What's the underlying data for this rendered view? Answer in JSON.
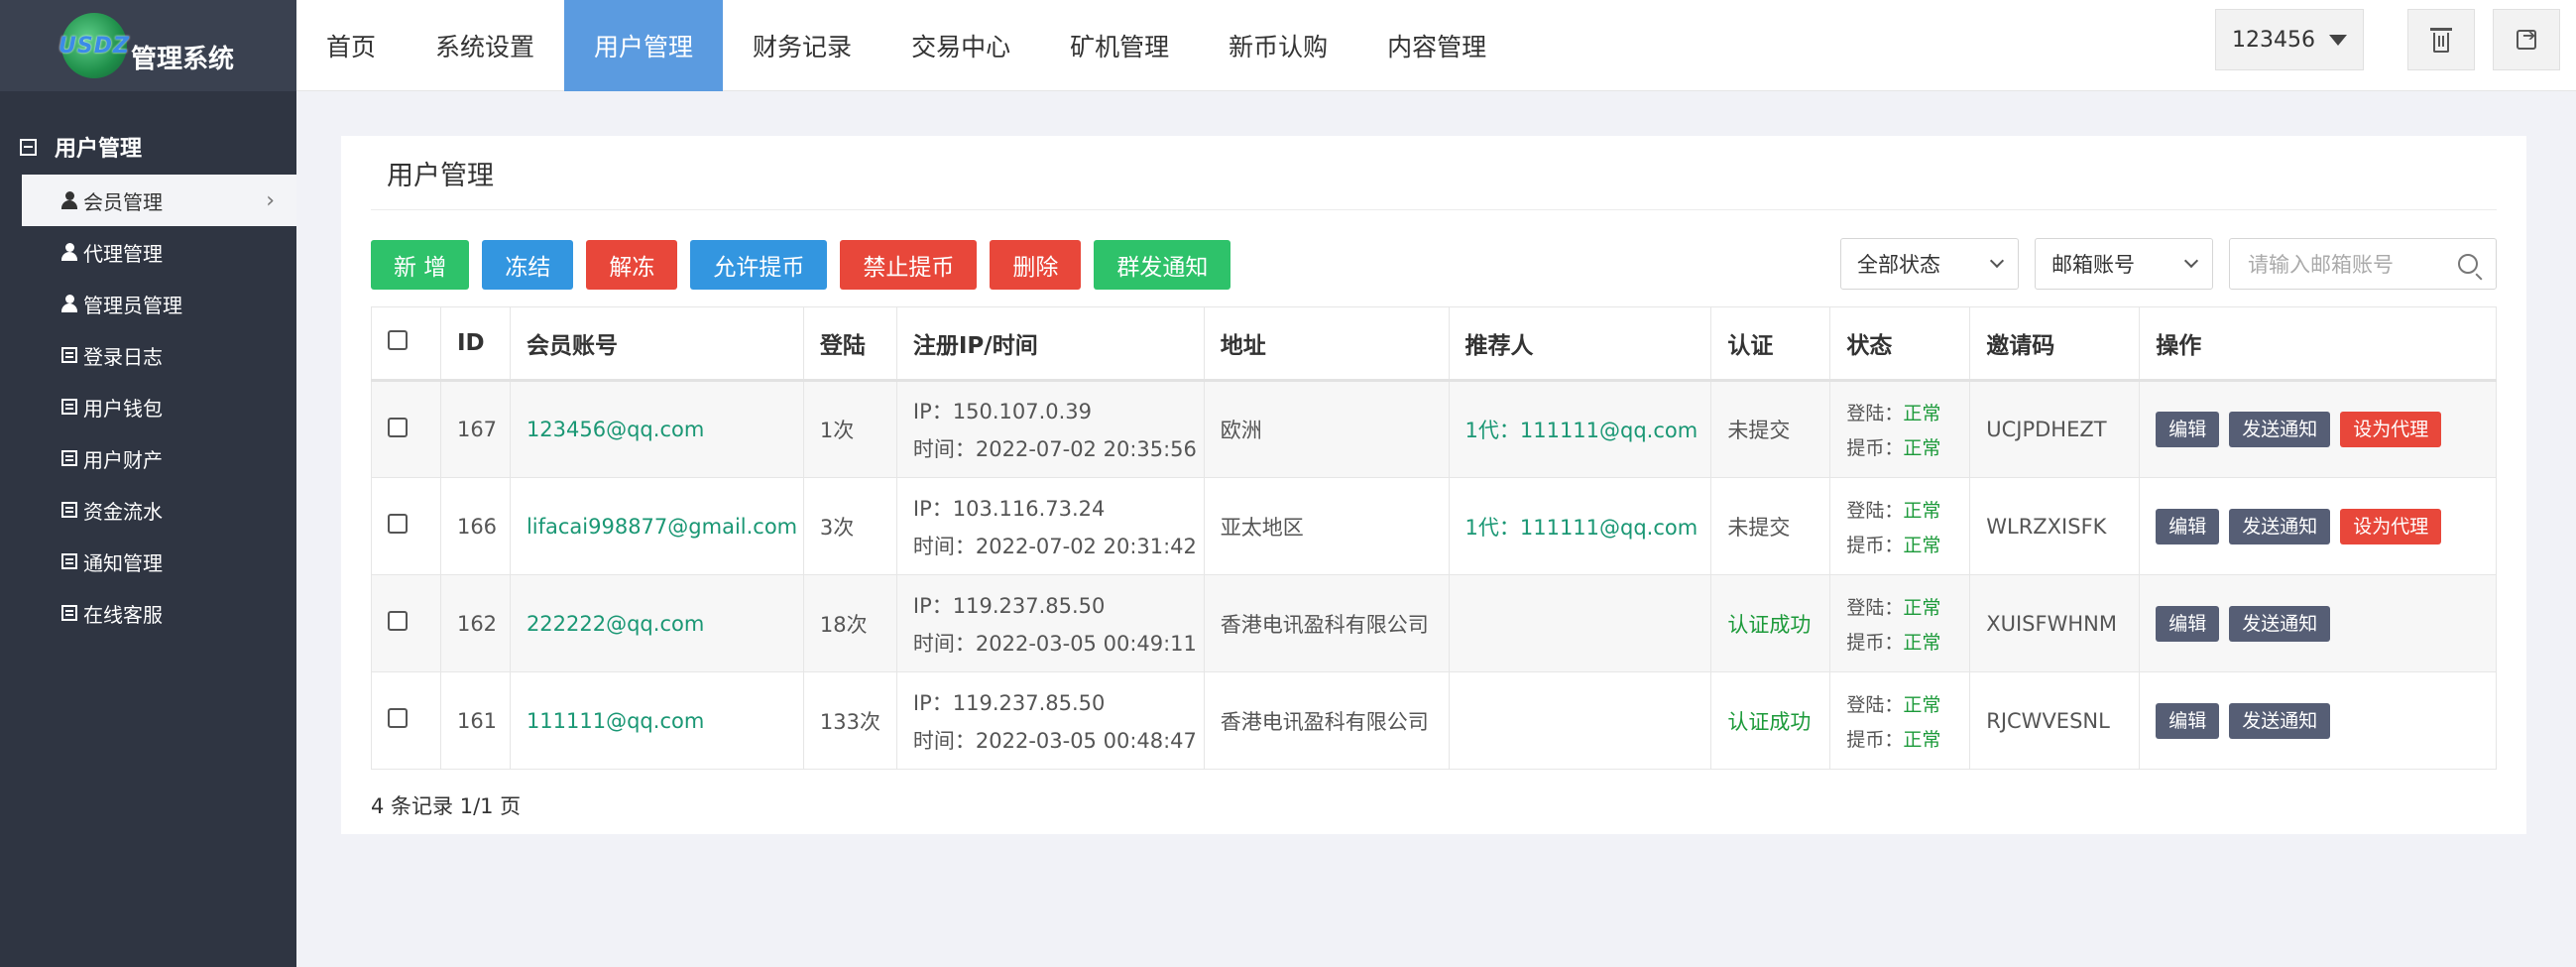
{
  "app": {
    "logo_text": "USDZ",
    "title": "管理系统"
  },
  "sidebar": {
    "group_label": "用户管理",
    "items": [
      {
        "label": "会员管理",
        "icon": "person-icon",
        "active": true
      },
      {
        "label": "代理管理",
        "icon": "person-icon"
      },
      {
        "label": "管理员管理",
        "icon": "person-icon"
      },
      {
        "label": "登录日志",
        "icon": "list-icon"
      },
      {
        "label": "用户钱包",
        "icon": "list-icon"
      },
      {
        "label": "用户财产",
        "icon": "list-icon"
      },
      {
        "label": "资金流水",
        "icon": "list-icon"
      },
      {
        "label": "通知管理",
        "icon": "list-icon"
      },
      {
        "label": "在线客服",
        "icon": "list-icon"
      }
    ]
  },
  "topnav": {
    "items": [
      "首页",
      "系统设置",
      "用户管理",
      "财务记录",
      "交易中心",
      "矿机管理",
      "新币认购",
      "内容管理"
    ],
    "active_index": 2,
    "user": "123456"
  },
  "page": {
    "title": "用户管理",
    "buttons": {
      "add": "新 增",
      "freeze": "冻结",
      "unfreeze": "解冻",
      "allow_withdraw": "允许提币",
      "forbid_withdraw": "禁止提币",
      "delete": "删除",
      "broadcast": "群发通知"
    },
    "filters": {
      "status": "全部状态",
      "field": "邮箱账号",
      "search_placeholder": "请输入邮箱账号"
    },
    "table": {
      "headers": [
        "ID",
        "会员账号",
        "登陆",
        "注册IP/时间",
        "地址",
        "推荐人",
        "认证",
        "状态",
        "邀请码",
        "操作"
      ],
      "rows": [
        {
          "id": "167",
          "account": "123456@qq.com",
          "logins": "1次",
          "ip": "IP：150.107.0.39",
          "time": "时间：2022-07-02 20:35:56",
          "address": "欧洲",
          "referrer": "1代：111111@qq.com",
          "auth": "未提交",
          "auth_ok": false,
          "login_status_label": "登陆：",
          "login_status": "正常",
          "withdraw_status_label": "提币：",
          "withdraw_status": "正常",
          "invite": "UCJPDHEZT",
          "actions": [
            "编辑",
            "发送通知",
            "设为代理"
          ]
        },
        {
          "id": "166",
          "account": "lifacai998877@gmail.com",
          "logins": "3次",
          "ip": "IP：103.116.73.24",
          "time": "时间：2022-07-02 20:31:42",
          "address": "亚太地区",
          "referrer": "1代：111111@qq.com",
          "auth": "未提交",
          "auth_ok": false,
          "login_status_label": "登陆：",
          "login_status": "正常",
          "withdraw_status_label": "提币：",
          "withdraw_status": "正常",
          "invite": "WLRZXISFK",
          "actions": [
            "编辑",
            "发送通知",
            "设为代理"
          ]
        },
        {
          "id": "162",
          "account": "222222@qq.com",
          "logins": "18次",
          "ip": "IP：119.237.85.50",
          "time": "时间：2022-03-05 00:49:11",
          "address": "香港电讯盈科有限公司",
          "referrer": "",
          "auth": "认证成功",
          "auth_ok": true,
          "login_status_label": "登陆：",
          "login_status": "正常",
          "withdraw_status_label": "提币：",
          "withdraw_status": "正常",
          "invite": "XUISFWHNM",
          "actions": [
            "编辑",
            "发送通知"
          ]
        },
        {
          "id": "161",
          "account": "111111@qq.com",
          "logins": "133次",
          "ip": "IP：119.237.85.50",
          "time": "时间：2022-03-05 00:48:47",
          "address": "香港电讯盈科有限公司",
          "referrer": "",
          "auth": "认证成功",
          "auth_ok": true,
          "login_status_label": "登陆：",
          "login_status": "正常",
          "withdraw_status_label": "提币：",
          "withdraw_status": "正常",
          "invite": "RJCWVESNL",
          "actions": [
            "编辑",
            "发送通知"
          ]
        }
      ]
    },
    "pagination": "4 条记录 1/1 页"
  },
  "colors": {
    "sidebar_bg": "#2f3542",
    "nav_active": "#5b9be0",
    "green": "#2ec26a",
    "blue": "#3396e0",
    "red": "#e8473a",
    "link": "#1a9774",
    "ok": "#1c9a3a"
  }
}
